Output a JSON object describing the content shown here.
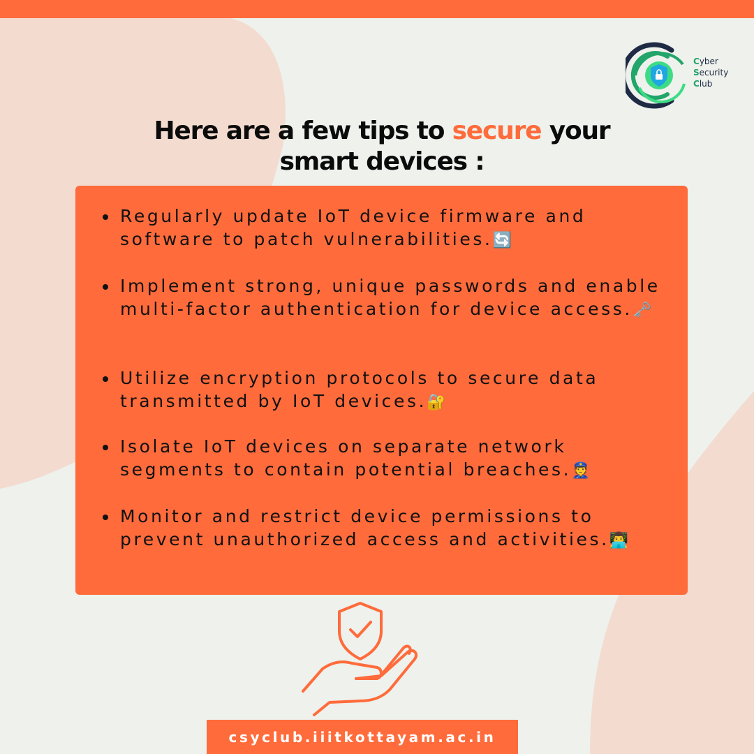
{
  "colors": {
    "accent": "#ff6b3b",
    "background": "#eef1ec",
    "blob": "#f3dbd0",
    "text": "#0b0b0b",
    "logo_navy": "#1f2a44",
    "logo_green": "#22a56a",
    "logo_light_green": "#3ddc84",
    "logo_blue": "#1ea7e1"
  },
  "logo": {
    "icon": "shield-lock-icon",
    "lines": [
      {
        "initial": "C",
        "rest": "yber"
      },
      {
        "initial": "S",
        "rest": "ecurity"
      },
      {
        "initial": "C",
        "rest": "lub"
      }
    ]
  },
  "headline": {
    "part1": "Here are a few tips to ",
    "highlight": "secure",
    "part2": " your",
    "line2": "smart devices :"
  },
  "tips": [
    {
      "text": "Regularly update IoT device firmware and software to patch vulnerabilities.",
      "emoji": "🔄"
    },
    {
      "text": "Implement strong, unique passwords and enable multi-factor authentication for device access.",
      "emoji": "🗝️"
    },
    {
      "text": "Utilize encryption protocols to secure data transmitted by IoT devices.",
      "emoji": "🔐"
    },
    {
      "text": "Isolate IoT devices on separate network segments to contain potential breaches.",
      "emoji": "👮"
    },
    {
      "text": "Monitor and restrict device permissions to prevent unauthorized access and activities.",
      "emoji": "👨‍💻"
    }
  ],
  "illustration": {
    "icon": "hand-shield-check-icon"
  },
  "footer": {
    "url": "csyclub.iiitkottayam.ac.in"
  }
}
